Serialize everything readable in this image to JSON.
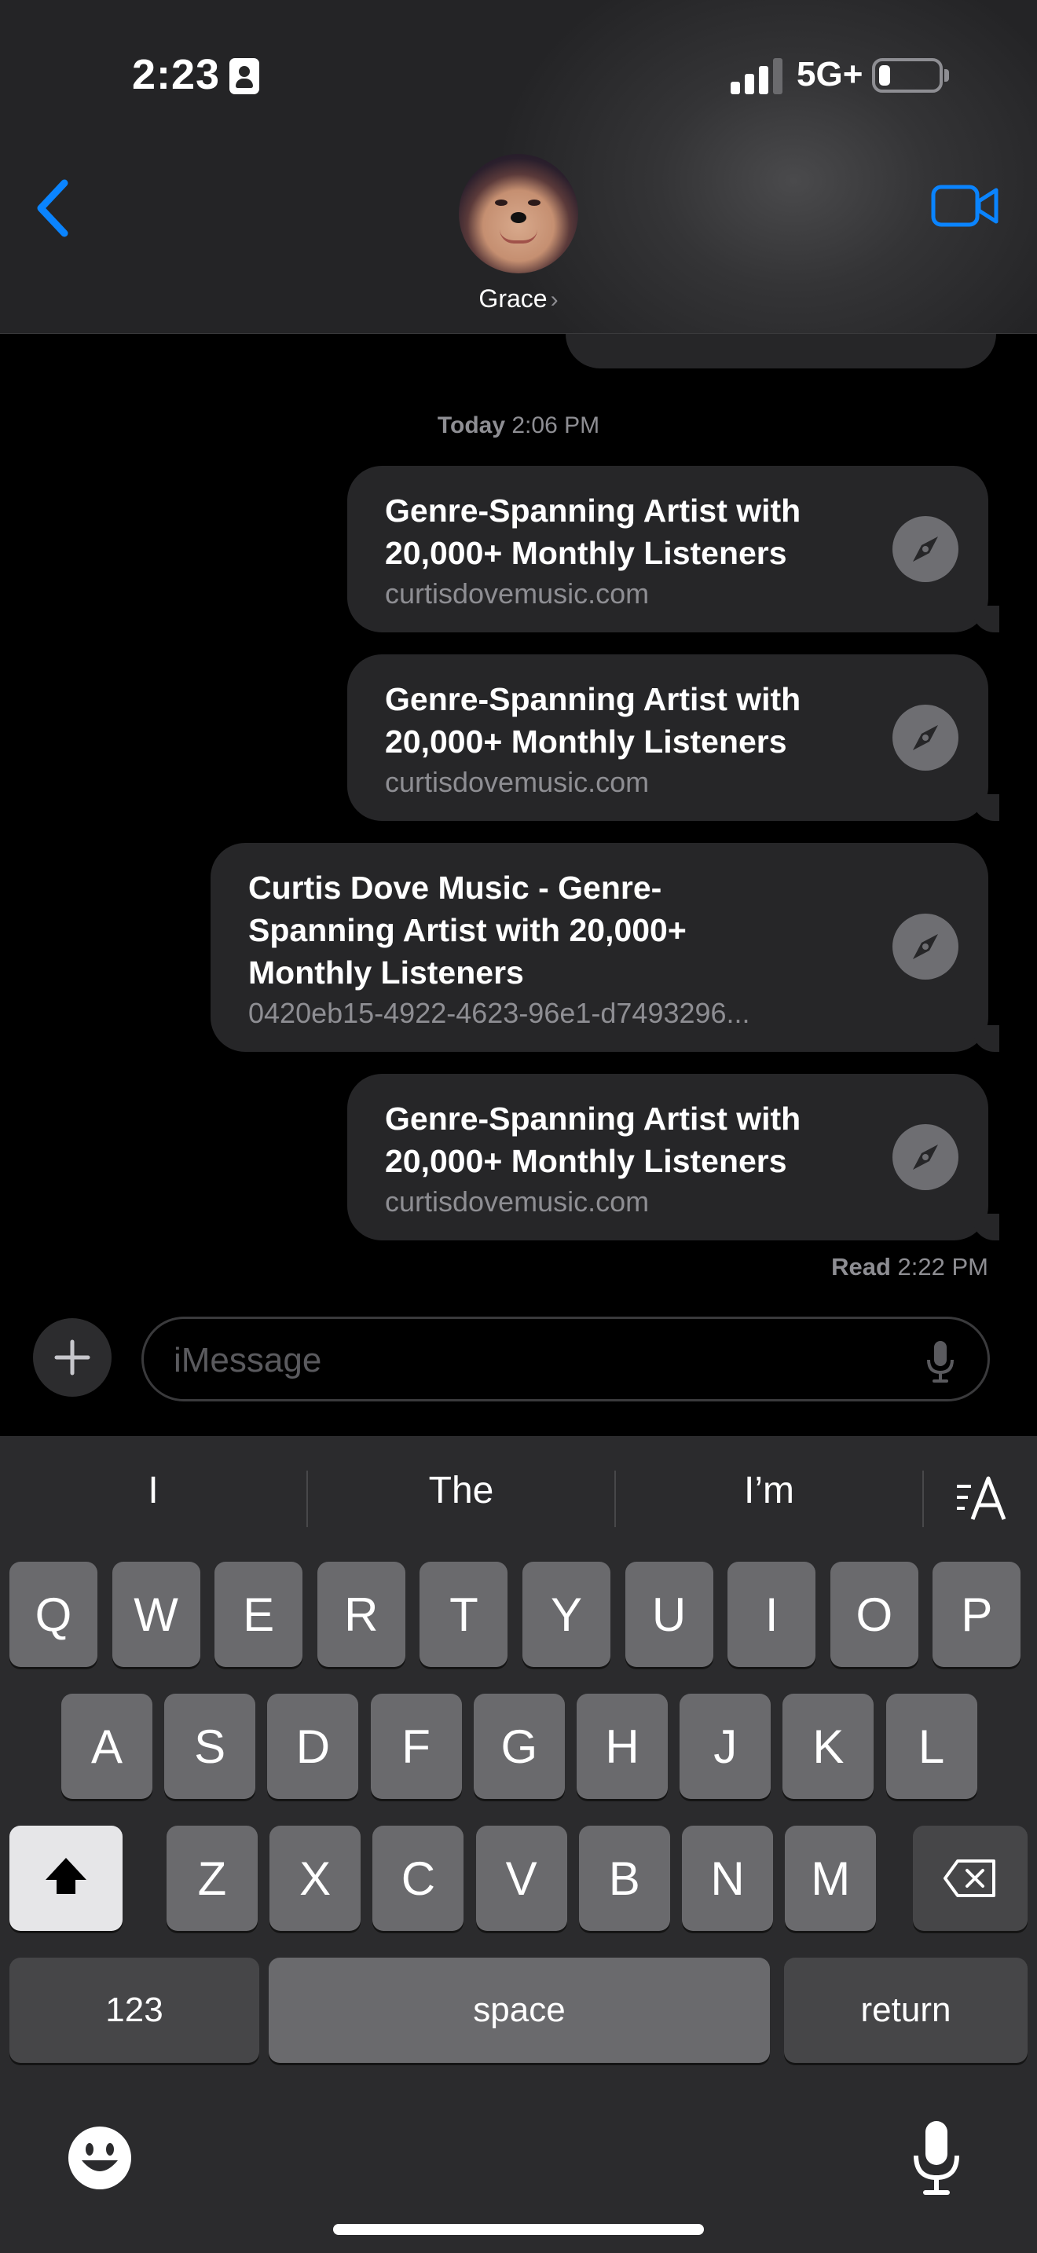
{
  "status_bar": {
    "time": "2:23",
    "network": "5G+",
    "signal_bars": 3,
    "battery_level": 0.2
  },
  "header": {
    "back_icon": "chevron-left-icon",
    "contact_name": "Grace",
    "contact_chevron": "›",
    "video_icon": "video-camera-icon"
  },
  "conversation": {
    "timestamp_label": "Today",
    "timestamp_time": "2:06 PM",
    "messages": [
      {
        "title": "Genre-Spanning Artist with 20,000+ Monthly Listeners",
        "domain": "curtisdovemusic.com",
        "icon": "compass-icon"
      },
      {
        "title": "Genre-Spanning Artist with 20,000+ Monthly Listeners",
        "domain": "curtisdovemusic.com",
        "icon": "compass-icon"
      },
      {
        "title": "Curtis Dove Music - Genre-Spanning Artist with 20,000+ Monthly Listeners",
        "domain": "0420eb15-4922-4623-96e1-d7493296...",
        "icon": "compass-icon"
      },
      {
        "title": "Genre-Spanning Artist with 20,000+ Monthly Listeners",
        "domain": "curtisdovemusic.com",
        "icon": "compass-icon"
      }
    ],
    "read_label": "Read",
    "read_time": "2:22 PM"
  },
  "input_bar": {
    "placeholder": "iMessage",
    "plus_icon": "plus-icon",
    "mic_icon": "microphone-icon"
  },
  "keyboard": {
    "suggestions": [
      "I",
      "The",
      "I’m"
    ],
    "format_icon": "text-format-icon",
    "row1": [
      "Q",
      "W",
      "E",
      "R",
      "T",
      "Y",
      "U",
      "I",
      "O",
      "P"
    ],
    "row2": [
      "A",
      "S",
      "D",
      "F",
      "G",
      "H",
      "J",
      "K",
      "L"
    ],
    "row3": [
      "Z",
      "X",
      "C",
      "V",
      "B",
      "N",
      "M"
    ],
    "shift_icon": "shift-icon",
    "delete_icon": "delete-backspace-icon",
    "numbers_label": "123",
    "space_label": "space",
    "return_label": "return",
    "emoji_icon": "emoji-icon",
    "dictation_icon": "microphone-icon"
  },
  "colors": {
    "accent": "#0a84ff",
    "bubble": "#262628",
    "keyboard_bg": "#2b2b2d",
    "key": "#6a6a6d",
    "secondary_text": "#8e8e93"
  }
}
